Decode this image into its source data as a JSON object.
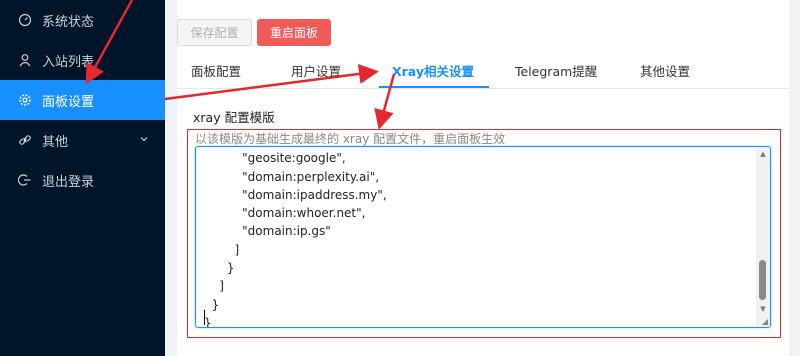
{
  "sidebar": {
    "items": [
      {
        "label": "系统状态",
        "icon": "dashboard-icon",
        "active": false
      },
      {
        "label": "入站列表",
        "icon": "user-icon",
        "active": false
      },
      {
        "label": "面板设置",
        "icon": "gear-icon",
        "active": true
      },
      {
        "label": "其他",
        "icon": "link-icon",
        "active": false,
        "has_submenu": true
      },
      {
        "label": "退出登录",
        "icon": "logout-icon",
        "active": false
      }
    ]
  },
  "toolbar": {
    "save_label": "保存配置",
    "restart_label": "重启面板"
  },
  "tabs": [
    {
      "label": "面板配置",
      "active": false
    },
    {
      "label": "用户设置",
      "active": false
    },
    {
      "label": "Xray相关设置",
      "active": true
    },
    {
      "label": "Telegram提醒",
      "active": false
    },
    {
      "label": "其他设置",
      "active": false
    }
  ],
  "section": {
    "title": "xray 配置模版",
    "hint": "以该模版为基础生成最终的 xray 配置文件，重启面板生效"
  },
  "editor": {
    "lines": [
      "          \"geosite:google\",",
      "          \"domain:perplexity.ai\",",
      "          \"domain:ipaddress.my\",",
      "          \"domain:whoer.net\",",
      "          \"domain:ip.gs\"",
      "        ]",
      "      }",
      "    ]",
      "  }",
      "}"
    ],
    "scroll_position": 0.88
  },
  "colors": {
    "sidebar_bg": "#001529",
    "accent": "#1890ff",
    "restart_button": "#ef5b58",
    "annotation_red": "#e5282e"
  }
}
